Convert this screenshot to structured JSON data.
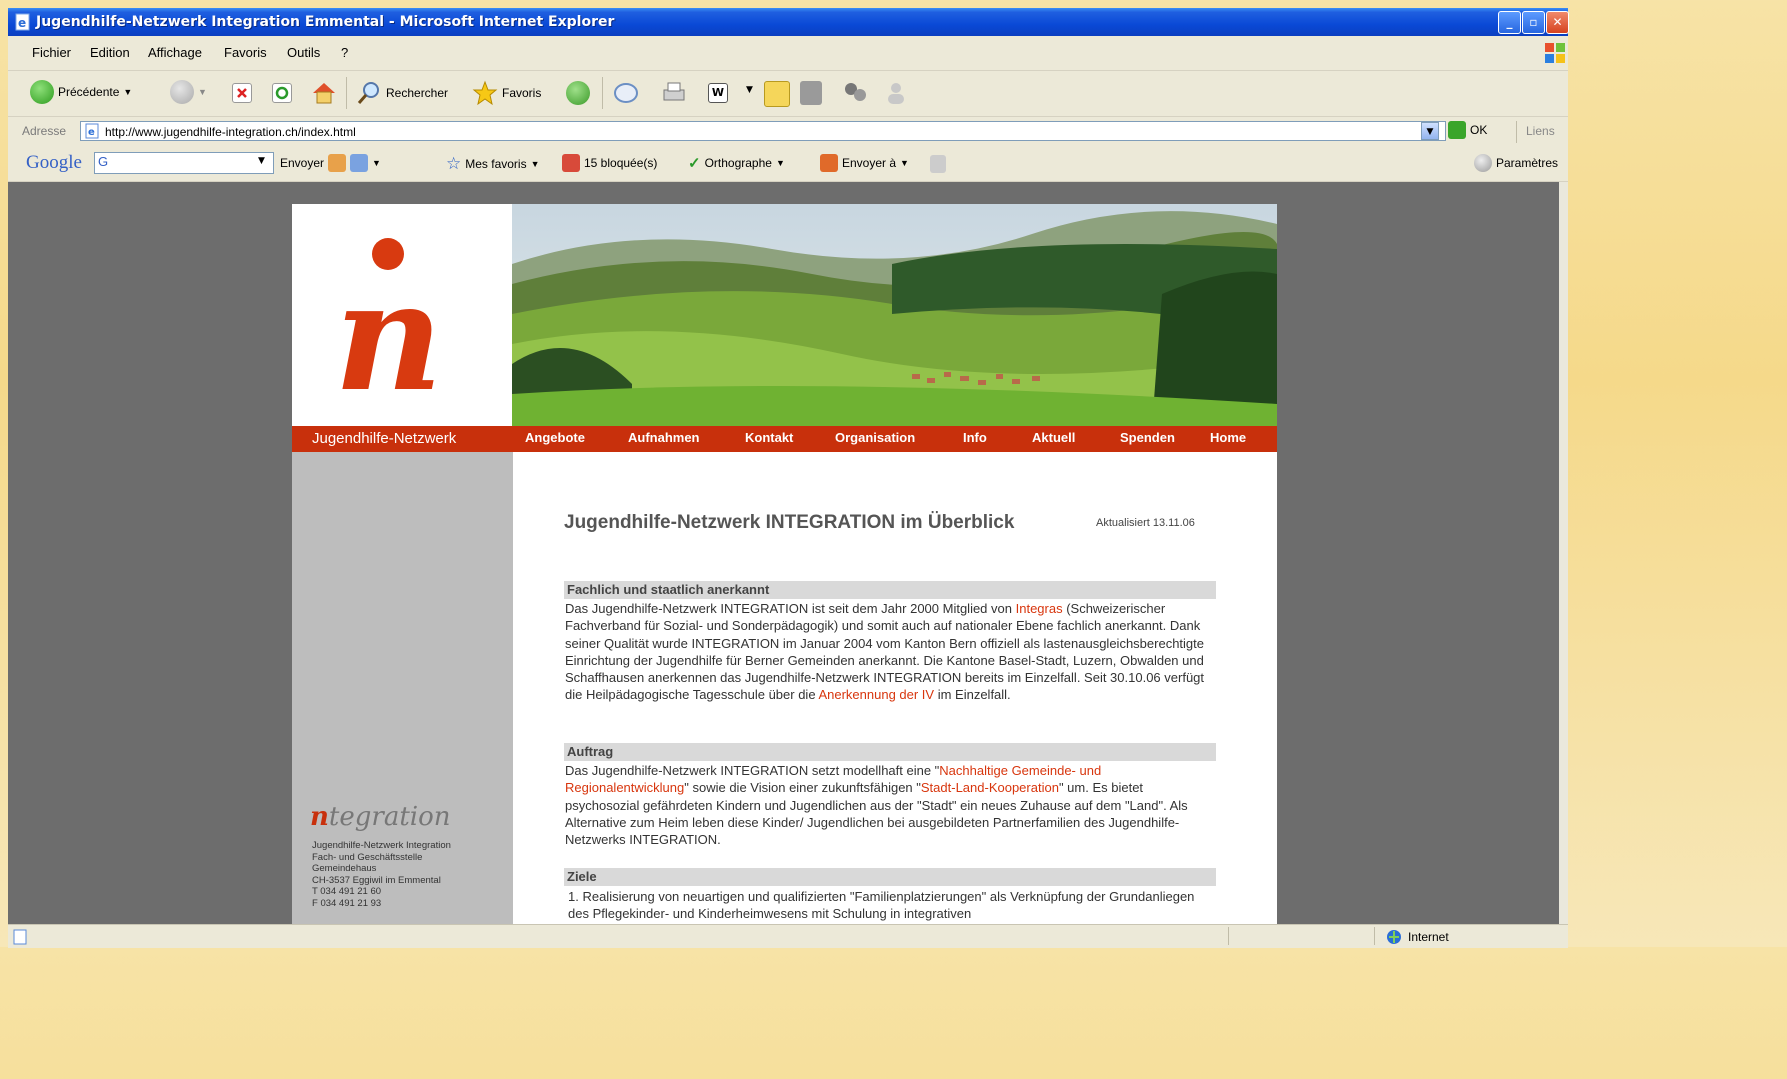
{
  "window": {
    "title": "Jugendhilfe-Netzwerk Integration Emmental - Microsoft Internet Explorer"
  },
  "menu": [
    "Fichier",
    "Edition",
    "Affichage",
    "Favoris",
    "Outils",
    "?"
  ],
  "toolbar": {
    "back_label": "Précédente",
    "search_label": "Rechercher",
    "favorites_label": "Favoris"
  },
  "address": {
    "label": "Adresse",
    "url": "http://www.jugendhilfe-integration.ch/index.html",
    "go_label": "OK",
    "links_label": "Liens"
  },
  "googlebar": {
    "logo": "Google",
    "search_prefix": "G",
    "send_label": "Envoyer",
    "bookmarks_label": "Mes favoris",
    "blocked_label": "15 bloquée(s)",
    "spelling_label": "Orthographe",
    "sendto_label": "Envoyer à",
    "settings_label": "Paramètres"
  },
  "statusbar": {
    "zone": "Internet"
  },
  "site": {
    "nav_brand": "Jugendhilfe-Netzwerk",
    "nav": [
      "Angebote",
      "Aufnahmen",
      "Kontakt",
      "Organisation",
      "Info",
      "Aktuell",
      "Spenden",
      "Home"
    ],
    "title": "Jugendhilfe-Netzwerk INTEGRATION im Überblick",
    "updated": "Aktualisiert 13.11.06",
    "sections": [
      {
        "heading": "Fachlich und staatlich anerkannt",
        "text_before": "Das Jugendhilfe-Netzwerk INTEGRATION ist seit dem Jahr 2000 Mitglied von ",
        "link1": "Integras",
        "text_mid": " (Schweizerischer Fachverband für Sozial- und Sonderpädagogik) und somit auch auf nationaler Ebene fachlich anerkannt. Dank seiner Qualität wurde INTEGRATION im Januar 2004 vom Kanton Bern offiziell als lastenausgleichsberechtigte Einrichtung der Jugendhilfe für Berner Gemeinden anerkannt. Die Kantone Basel-Stadt, Luzern, Obwalden und Schaffhausen anerkennen das Jugendhilfe-Netzwerk INTEGRATION bereits im Einzelfall. Seit 30.10.06 verfügt die Heilpädagogische Tagesschule über die ",
        "link2": "Anerkennung der IV",
        "text_after": " im Einzelfall."
      },
      {
        "heading": "Auftrag",
        "text_before": "Das Jugendhilfe-Netzwerk INTEGRATION setzt modellhaft eine \"",
        "link1": "Nachhaltige Gemeinde- und Regionalentwicklung",
        "text_mid": "\" sowie die Vision einer zukunftsfähigen \"",
        "link2": "Stadt-Land-Kooperation",
        "text_after": "\" um. Es bietet psychosozial gefährdeten Kindern und Jugendlichen aus der \"Stadt\" ein neues Zuhause auf dem \"Land\". Als Alternative zum Heim leben diese Kinder/ Jugendlichen bei ausgebildeten Partnerfamilien des Jugendhilfe-Netzwerks INTEGRATION."
      },
      {
        "heading": "Ziele",
        "list_item_1": "1.  Realisierung von neuartigen und qualifizierten \"Familienplatzierungen\" als Verknüpfung der Grundanliegen des Pflegekinder- und Kinderheimwesens mit Schulung in integrativen"
      }
    ],
    "org": {
      "logo_initial": "n",
      "logo_rest": "tegration",
      "address_lines": [
        "Jugendhilfe-Netzwerk Integration",
        "Fach- und Geschäftsstelle",
        "Gemeindehaus",
        "CH-3537 Eggiwil im Emmental",
        "T 034 491 21 60",
        "F 034 491 21 93"
      ]
    }
  }
}
